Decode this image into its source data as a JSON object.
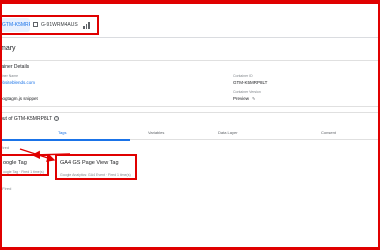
{
  "top_chips": {
    "primary_label": "GTM-K5MRP8LT",
    "secondary_label": "G-91WRM4AUS",
    "icon_bars": "bar-chart-icon"
  },
  "summary": {
    "title": "mary"
  },
  "container": {
    "section_title": "tainer Details",
    "name_label": "ainer Name",
    "name_value": "ebsiteblends.com",
    "id_label": "Container ID",
    "id_value": "GTM-K5MRP8LT",
    "url_label": "e",
    "url_value": "oogtagm.js snippet",
    "version_label": "Container Version",
    "version_value": "Preview"
  },
  "output": {
    "title": "put of GTM-K5MRP8LT",
    "tabs": [
      "Tags",
      "Variables",
      "Data Layer",
      "Consent"
    ],
    "fired_header": "Fired",
    "not_fired_header": "t Fired",
    "fired_tags": [
      {
        "name": "oogle Tag",
        "subtitle": "oogle Tag · Fired 1 time(s)"
      },
      {
        "name": "GA4 GS Page View Tag",
        "subtitle": "Google Analytics: GA4 Event · Fired 1 time(s)"
      }
    ]
  },
  "colors": {
    "annotation": "#e00000",
    "accent": "#1a73e8"
  }
}
